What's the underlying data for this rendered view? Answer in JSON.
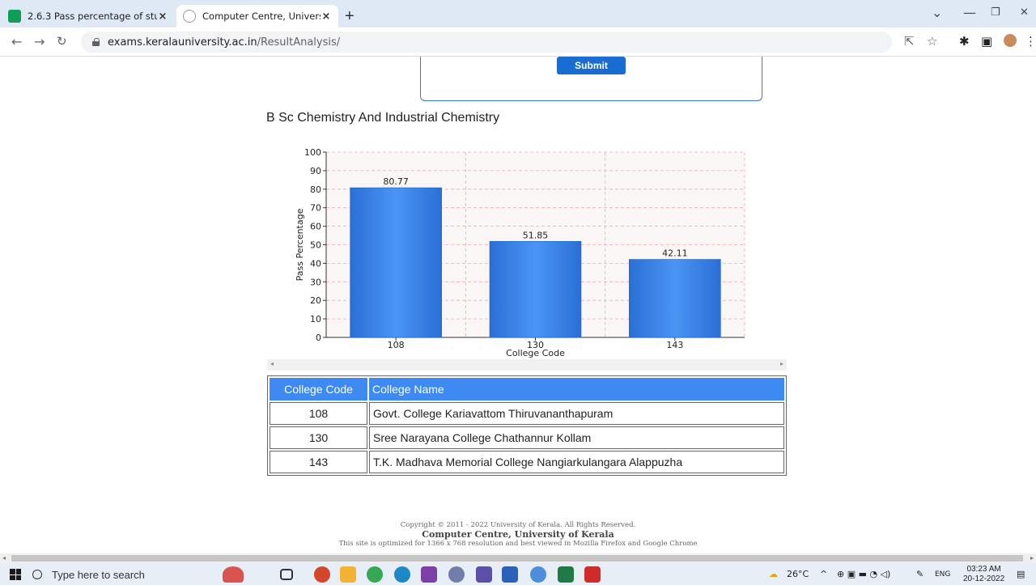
{
  "browser": {
    "tabs": [
      {
        "title": "2.6.3 Pass percentage of student",
        "active": false
      },
      {
        "title": "Computer Centre, University of K",
        "active": true
      }
    ],
    "new_tab": "+",
    "url_host": "exams.keralauniversity.ac.in",
    "url_path": "/ResultAnalysis/",
    "window_controls": {
      "minimize": "—",
      "maximize": "❐",
      "close": "✕",
      "dropdown": "⌄"
    }
  },
  "form": {
    "submit_label": "Submit"
  },
  "course_title": "B Sc Chemistry And Industrial Chemistry",
  "chart_data": {
    "type": "bar",
    "categories": [
      "108",
      "130",
      "143"
    ],
    "values": [
      80.77,
      51.85,
      42.11
    ],
    "xlabel": "College Code",
    "ylabel": "Pass Percentage",
    "ylim": [
      0,
      100
    ],
    "yticks": [
      0,
      10,
      20,
      30,
      40,
      50,
      60,
      70,
      80,
      90,
      100
    ],
    "grid": true,
    "bar_color": "#3d8bf2"
  },
  "table": {
    "headers": [
      "College Code",
      "College Name"
    ],
    "rows": [
      {
        "code": "108",
        "name": "Govt. College Kariavattom Thiruvananthapuram"
      },
      {
        "code": "130",
        "name": "Sree Narayana College Chathannur Kollam"
      },
      {
        "code": "143",
        "name": "T.K. Madhava Memorial College Nangiarkulangara Alappuzha"
      }
    ]
  },
  "footer": {
    "copyright": "Copyright © 2011 - 2022 University of Kerala. All Rights Reserved.",
    "org": "Computer Centre, University of Kerala",
    "note": "This site is optimized for 1366 x 768 resolution and best viewed in Mozilla Firefox and Google Chrome"
  },
  "taskbar": {
    "search_placeholder": "Type here to search",
    "weather": "26°C",
    "language": "ENG",
    "time": "03:23 AM",
    "date": "20-12-2022"
  }
}
